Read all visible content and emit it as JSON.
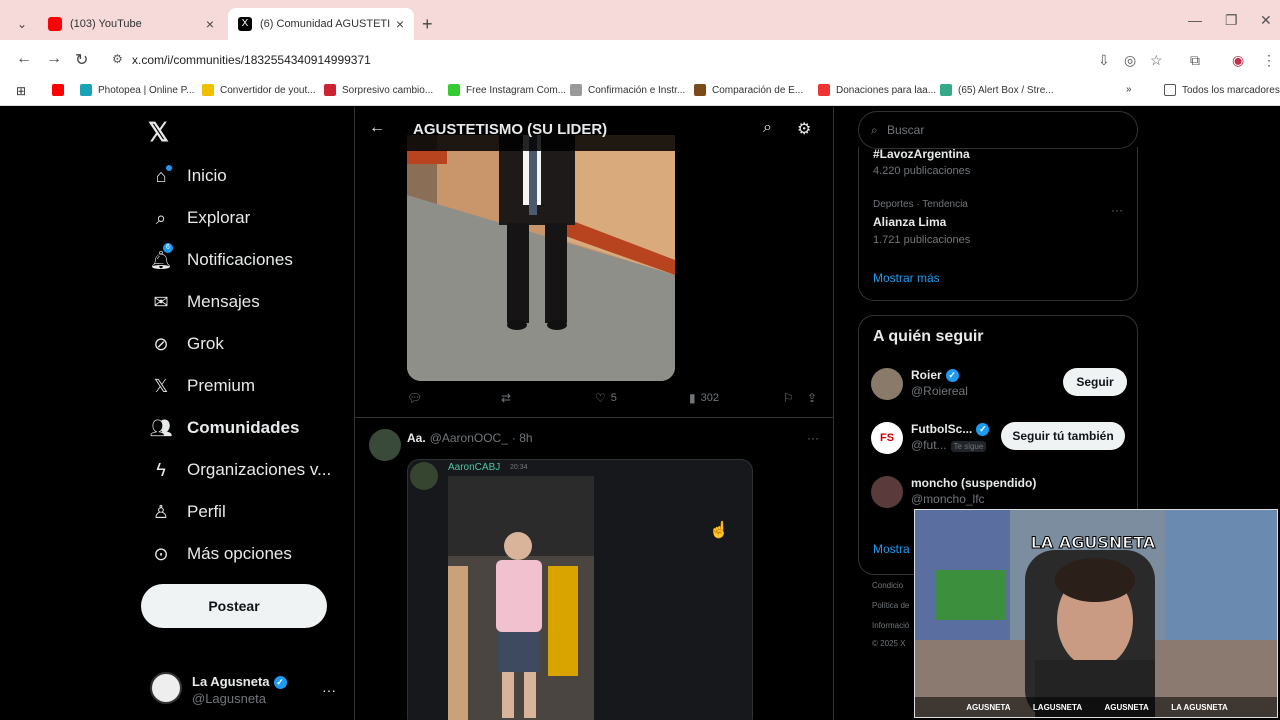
{
  "browser": {
    "tabs": [
      {
        "title": "(103) YouTube",
        "active": false
      },
      {
        "title": "(6) Comunidad AGUSTETISMO (",
        "active": true
      }
    ],
    "url": "x.com/i/communities/1832554340914999371",
    "bookmarks": [
      "Photopea | Online P...",
      "Convertidor de yout...",
      "Sorpresivo cambio...",
      "Free Instagram Com...",
      "Confirmación e Instr...",
      "Comparación de E...",
      "Donaciones para laa...",
      "(65) Alert Box / Stre...",
      "Todos los marcadores"
    ]
  },
  "sidebar": {
    "items": [
      {
        "label": "Inicio",
        "icon": "home-icon"
      },
      {
        "label": "Explorar",
        "icon": "search-icon"
      },
      {
        "label": "Notificaciones",
        "icon": "bell-icon",
        "badge": "6"
      },
      {
        "label": "Mensajes",
        "icon": "mail-icon"
      },
      {
        "label": "Grok",
        "icon": "grok-icon"
      },
      {
        "label": "Premium",
        "icon": "x-logo-icon"
      },
      {
        "label": "Comunidades",
        "icon": "communities-icon"
      },
      {
        "label": "Organizaciones v...",
        "icon": "lightning-icon"
      },
      {
        "label": "Perfil",
        "icon": "person-icon"
      },
      {
        "label": "Más opciones",
        "icon": "more-circle-icon"
      }
    ],
    "post_label": "Postear",
    "profile": {
      "name": "La Agusneta",
      "handle": "@Lagusneta"
    }
  },
  "community": {
    "title": "AGUSTETISMO (SU LIDER)",
    "post1": {
      "likes": "5",
      "views": "302"
    },
    "post2": {
      "name": "Aa.",
      "handle": "@AaronOOC_",
      "time": "· 8h",
      "embed_name": "AaronCABJ",
      "embed_time": "20:34"
    }
  },
  "right": {
    "search_placeholder": "Buscar",
    "trends": [
      {
        "meta": "",
        "name": "#LavozArgentina",
        "count": "4.220 publicaciones"
      },
      {
        "meta": "Deportes · Tendencia",
        "name": "Alianza Lima",
        "count": "1.721 publicaciones"
      }
    ],
    "show_more": "Mostrar más",
    "follow_title": "A quién seguir",
    "follow": [
      {
        "name": "Roier",
        "handle": "@Roiereal",
        "button": "Seguir",
        "verified": true
      },
      {
        "name": "FutbolSc...",
        "handle": "@fut...",
        "tag": "Te sigue",
        "button": "Seguir tú también",
        "verified": true
      },
      {
        "name": "moncho (suspendido)",
        "handle": "@moncho_lfc",
        "button": "",
        "verified": false
      }
    ],
    "follow_more": "Mostra",
    "footer": [
      "Condicio",
      "Política de",
      "Informació",
      "© 2025 X"
    ]
  },
  "stream": {
    "overlay": "LA AGUSNETA",
    "socials": [
      "AGUSNETA",
      "LAGUSNETA",
      "AGUSNETA",
      "LA AGUSNETA"
    ]
  },
  "colors": {
    "accent": "#1d9bf0",
    "bg": "#000000",
    "border": "#2f3336"
  }
}
